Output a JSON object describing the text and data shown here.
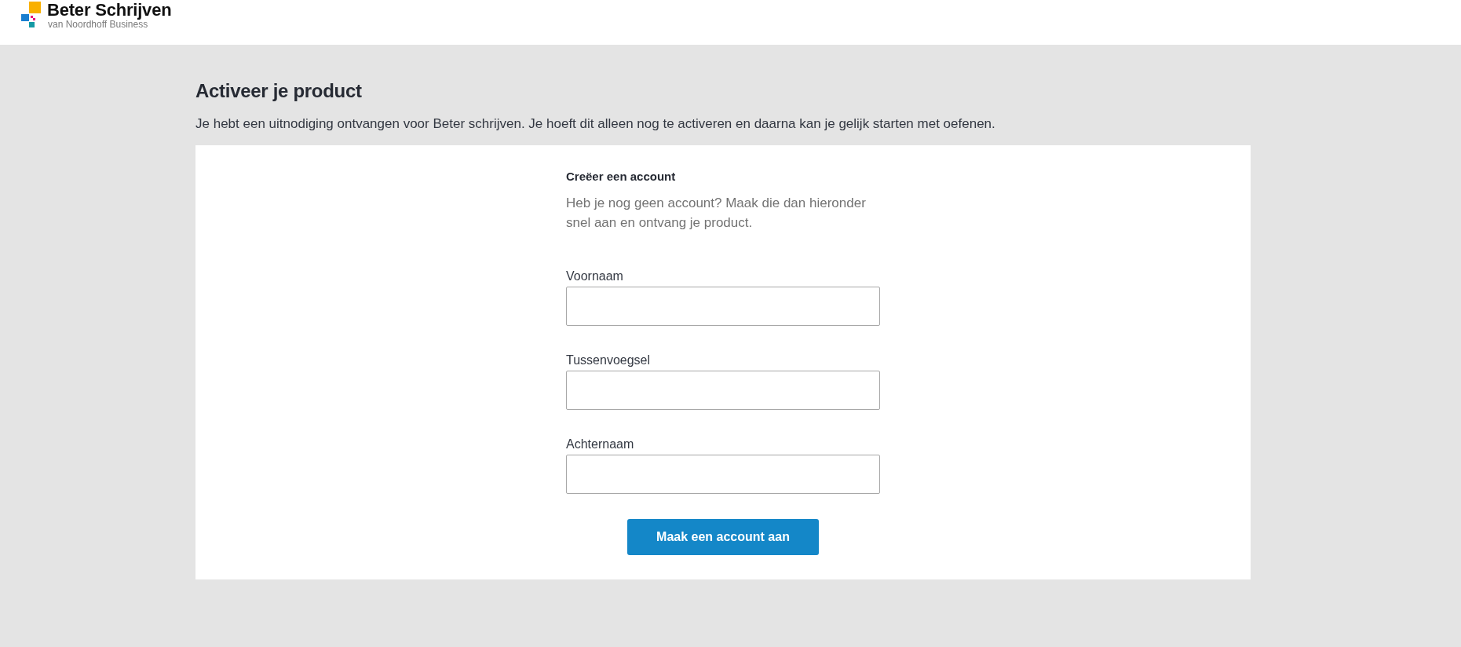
{
  "header": {
    "logo": {
      "title": "Beter Schrijven",
      "subtitle": "van Noordhoff Business"
    }
  },
  "page": {
    "title": "Activeer je product",
    "intro": "Je hebt een uitnodiging ontvangen voor Beter schrijven. Je hoeft dit alleen nog te activeren en daarna kan je gelijk starten met oefenen."
  },
  "form": {
    "title": "Creëer een account",
    "description": "Heb je nog geen account? Maak die dan hieronder snel aan en ontvang je product.",
    "fields": [
      {
        "label": "Voornaam"
      },
      {
        "label": "Tussenvoegsel"
      },
      {
        "label": "Achternaam"
      }
    ],
    "submit": "Maak een account aan"
  }
}
